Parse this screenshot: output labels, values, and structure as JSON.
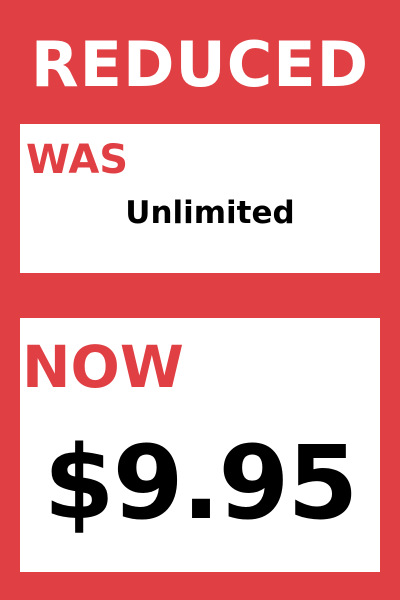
{
  "colors": {
    "background": "#e03f44",
    "panel": "#ffffff",
    "accent_text": "#e03f44",
    "value_text": "#000000"
  },
  "headline": "REDUCED",
  "was": {
    "label": "WAS",
    "value": "Unlimited"
  },
  "now": {
    "label": "NOW",
    "price": "$9.95"
  }
}
